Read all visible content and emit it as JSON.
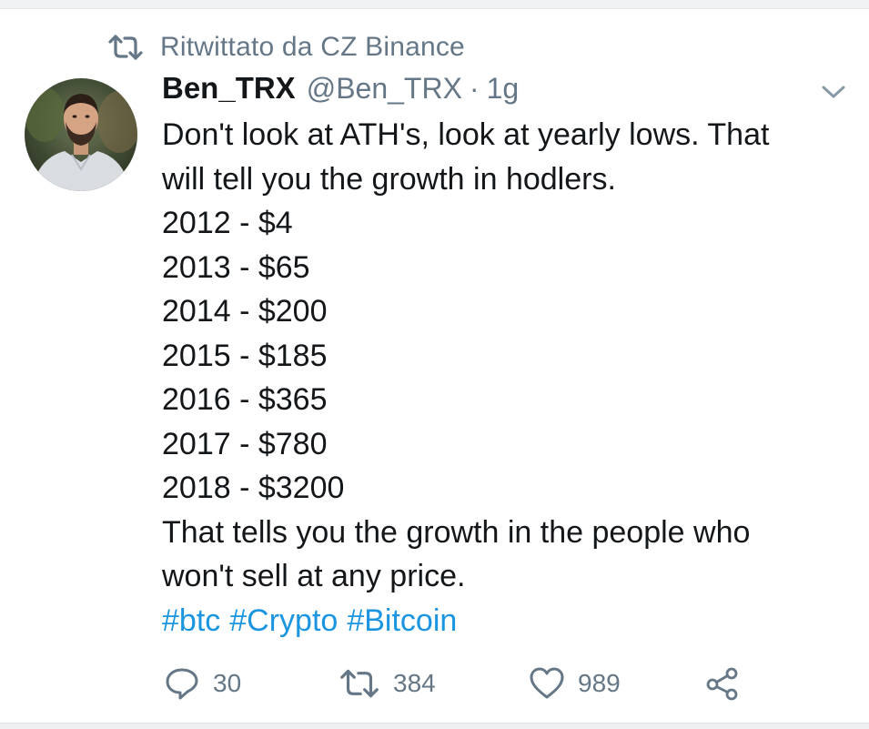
{
  "retweet_context": {
    "text": "Ritwittato da CZ Binance",
    "icon": "retweet-icon"
  },
  "tweet": {
    "author": {
      "display_name": "Ben_TRX",
      "handle": "@Ben_TRX",
      "avatar": "avatar-photo"
    },
    "separator": "·",
    "timestamp": "1g",
    "menu_icon": "chevron-down-icon",
    "lines": [
      "Don't look at ATH's, look at yearly lows. That",
      "will tell you the growth in hodlers.",
      "2012 - $4",
      "2013 - $65",
      "2014 - $200",
      "2015 - $185",
      "2016 - $365",
      "2017 - $780",
      "2018 - $3200",
      "That tells you the growth in the people who",
      "won't sell at any price."
    ],
    "hashtags": [
      "#btc",
      "#Crypto",
      "#Bitcoin"
    ]
  },
  "actions": {
    "reply": {
      "icon": "reply-icon",
      "count": "30"
    },
    "retweet": {
      "icon": "retweet-icon",
      "count": "384"
    },
    "like": {
      "icon": "heart-icon",
      "count": "989"
    },
    "share": {
      "icon": "share-icon"
    }
  },
  "colors": {
    "text": "#14171a",
    "muted": "#657786",
    "link": "#1b95e0",
    "background": "#ffffff"
  }
}
